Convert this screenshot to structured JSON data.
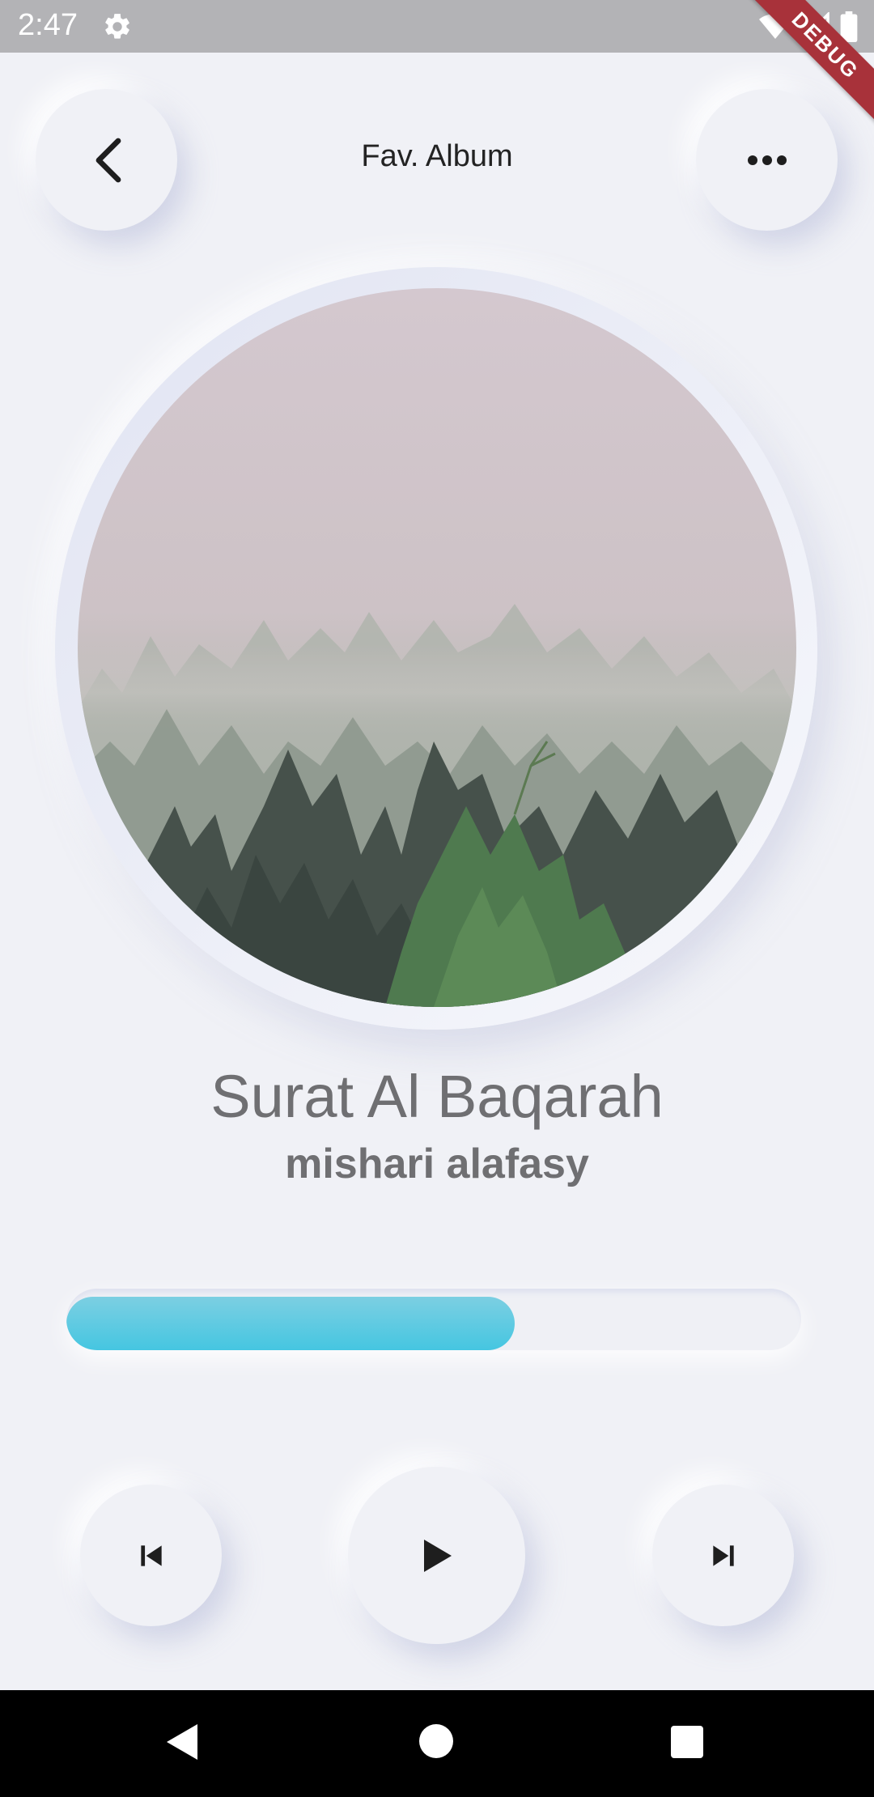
{
  "status_bar": {
    "time": "2:47",
    "icons": [
      "settings-icon",
      "wifi-icon",
      "signal-icon",
      "battery-icon"
    ],
    "background": "#b3b3b6"
  },
  "debug_banner": {
    "label": "DEBUG",
    "color": "#a8323a"
  },
  "header": {
    "title": "Fav. Album",
    "back_icon": "chevron-left-icon",
    "more_icon": "more-horizontal-icon"
  },
  "album": {
    "art_icon": "foggy-forest-artwork"
  },
  "track": {
    "title": "Surat Al Baqarah",
    "artist": "mishari alafasy"
  },
  "progress": {
    "fraction": 0.61,
    "fill_color": "#45c6e1"
  },
  "controls": {
    "previous_icon": "skip-previous-icon",
    "play_icon": "play-icon",
    "next_icon": "skip-next-icon"
  },
  "nav_bar": {
    "icons": [
      "back-triangle-icon",
      "home-circle-icon",
      "recents-square-icon"
    ]
  },
  "colors": {
    "background": "#f0f1f6",
    "text_primary": "#232323",
    "text_secondary": "#6f6f72",
    "accent": "#45c6e1"
  }
}
